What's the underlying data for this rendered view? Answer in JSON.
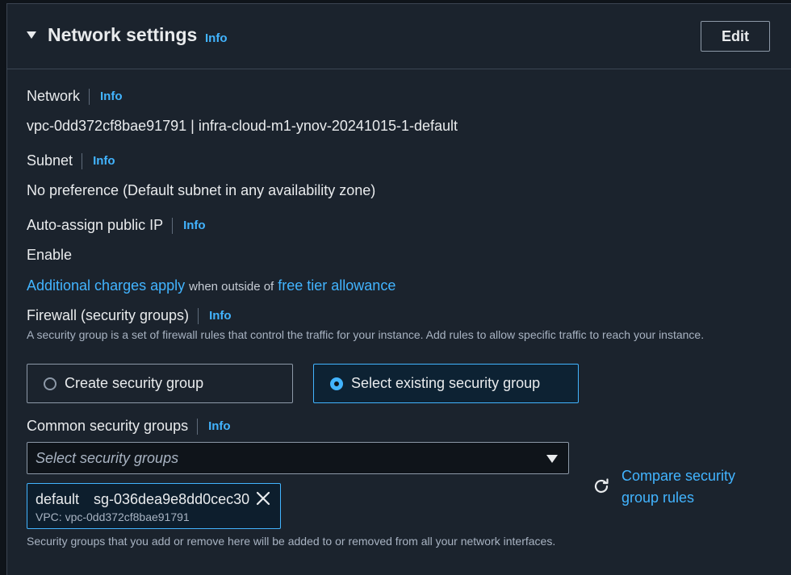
{
  "header": {
    "title": "Network settings",
    "info": "Info",
    "edit_label": "Edit"
  },
  "network": {
    "label": "Network",
    "info": "Info",
    "value": "vpc-0dd372cf8bae91791 | infra-cloud-m1-ynov-20241015-1-default"
  },
  "subnet": {
    "label": "Subnet",
    "info": "Info",
    "value": "No preference (Default subnet in any availability zone)"
  },
  "public_ip": {
    "label": "Auto-assign public IP",
    "info": "Info",
    "value": "Enable"
  },
  "charges": {
    "link1": "Additional charges apply",
    "middle": "when outside of",
    "link2": "free tier allowance"
  },
  "firewall": {
    "label": "Firewall (security groups)",
    "info": "Info",
    "description": "A security group is a set of firewall rules that control the traffic for your instance. Add rules to allow specific traffic to reach your instance.",
    "options": [
      {
        "label": "Create security group",
        "selected": false
      },
      {
        "label": "Select existing security group",
        "selected": true
      }
    ]
  },
  "common_groups": {
    "label": "Common security groups",
    "info": "Info",
    "placeholder": "Select security groups",
    "selected": {
      "name": "default",
      "id": "sg-036dea9e8dd0cec30",
      "vpc": "VPC: vpc-0dd372cf8bae91791"
    },
    "compare_link": "Compare security group rules",
    "footer": "Security groups that you add or remove here will be added to or removed from all your network interfaces."
  },
  "colors": {
    "accent": "#42b4ff",
    "panel": "#1b232d",
    "background": "#0f141a"
  }
}
